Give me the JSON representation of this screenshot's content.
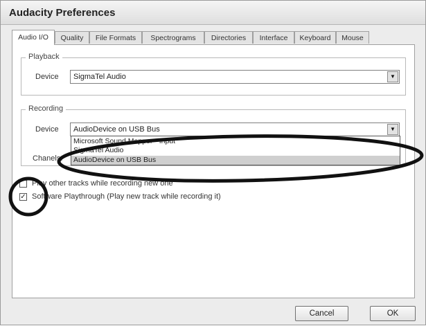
{
  "window": {
    "title": "Audacity Preferences"
  },
  "tabs": [
    {
      "label": "Audio I/O"
    },
    {
      "label": "Quality"
    },
    {
      "label": "File Formats"
    },
    {
      "label": "Spectrograms"
    },
    {
      "label": "Directories"
    },
    {
      "label": "Interface"
    },
    {
      "label": "Keyboard"
    },
    {
      "label": "Mouse"
    }
  ],
  "playback": {
    "legend": "Playback",
    "device_label": "Device",
    "device_value": "SigmaTel Audio"
  },
  "recording": {
    "legend": "Recording",
    "device_label": "Device",
    "device_value": "AudioDevice on USB Bus",
    "channels_label": "Chan",
    "channels_label_tail": "els:",
    "options": [
      {
        "label": "Microsoft Sound Mapper - Input"
      },
      {
        "label": "SigmaTel Audio"
      },
      {
        "label": "AudioDevice on USB Bus"
      }
    ],
    "selected_option": "AudioDevice on USB Bus"
  },
  "options": {
    "play_other_tracks": {
      "label": "Play other tracks while recording new one",
      "checked": false
    },
    "software_playthrough": {
      "label": "Software Playthrough (Play new track while recording it)",
      "checked": true
    }
  },
  "buttons": {
    "cancel": "Cancel",
    "ok": "OK"
  },
  "icons": {
    "dropdown": "chevron-down-icon",
    "check": "checkmark-icon"
  }
}
